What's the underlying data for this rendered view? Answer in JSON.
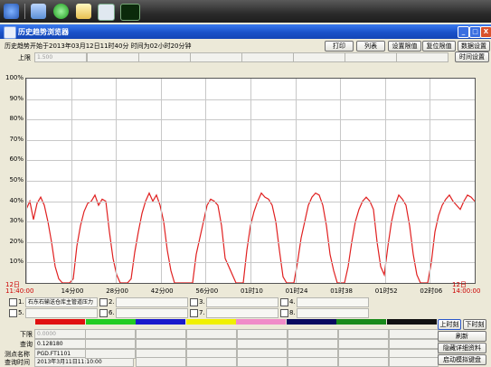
{
  "toolbar": {
    "icons": [
      "network-icon",
      "monitor-icon",
      "globe-icon",
      "notes-icon",
      "chart-icon",
      "signal-icon"
    ]
  },
  "window": {
    "title": "历史趋势浏览器",
    "min": "_",
    "max": "□",
    "close": "X"
  },
  "header": {
    "info": "历史趋势开始于2013年03月12日11时40分   时间为02小时20分钟",
    "upper_label": "上限",
    "upper_value": "1.500"
  },
  "buttons": {
    "print": "打印",
    "list": "列表",
    "set_limit": "设置限值",
    "reset_limit": "复位限值",
    "data_settings": "数据设置",
    "time_settings": "时间设置"
  },
  "chart_data": {
    "type": "line",
    "yticks": [
      "100%",
      "90%",
      "80%",
      "70%",
      "60%",
      "50%",
      "40%",
      "30%",
      "20%",
      "10%"
    ],
    "ylim": [
      0,
      100
    ],
    "xticks": [
      "12日\n11:40:00",
      "14分00",
      "28分00",
      "42分00",
      "56分00",
      "01时10",
      "01时24",
      "01时38",
      "01时52",
      "02时06",
      "12日\n14:00:00"
    ],
    "series": [
      {
        "color": "#e02020",
        "points": [
          [
            0,
            36
          ],
          [
            1,
            40
          ],
          [
            2,
            31
          ],
          [
            3,
            39
          ],
          [
            4,
            42
          ],
          [
            5,
            38
          ],
          [
            6,
            30
          ],
          [
            7,
            20
          ],
          [
            8,
            8
          ],
          [
            9,
            2
          ],
          [
            10,
            0
          ],
          [
            11,
            0
          ],
          [
            12,
            0
          ],
          [
            13,
            2
          ],
          [
            14,
            18
          ],
          [
            15,
            28
          ],
          [
            16,
            35
          ],
          [
            17,
            39
          ],
          [
            18,
            40
          ],
          [
            19,
            43
          ],
          [
            20,
            38
          ],
          [
            21,
            41
          ],
          [
            22,
            40
          ],
          [
            23,
            25
          ],
          [
            24,
            12
          ],
          [
            25,
            4
          ],
          [
            26,
            0
          ],
          [
            27,
            0
          ],
          [
            28,
            0
          ],
          [
            29,
            2
          ],
          [
            30,
            15
          ],
          [
            31,
            25
          ],
          [
            32,
            34
          ],
          [
            33,
            40
          ],
          [
            34,
            44
          ],
          [
            35,
            40
          ],
          [
            36,
            43
          ],
          [
            37,
            38
          ],
          [
            38,
            30
          ],
          [
            39,
            16
          ],
          [
            40,
            6
          ],
          [
            41,
            0
          ],
          [
            42,
            0
          ],
          [
            43,
            0
          ],
          [
            44,
            0
          ],
          [
            45,
            0
          ],
          [
            46,
            0
          ],
          [
            47,
            14
          ],
          [
            48,
            22
          ],
          [
            49,
            30
          ],
          [
            50,
            38
          ],
          [
            51,
            41
          ],
          [
            52,
            40
          ],
          [
            53,
            38
          ],
          [
            54,
            28
          ],
          [
            55,
            12
          ],
          [
            56,
            8
          ],
          [
            57,
            4
          ],
          [
            58,
            0
          ],
          [
            59,
            0
          ],
          [
            60,
            0
          ],
          [
            61,
            16
          ],
          [
            62,
            28
          ],
          [
            63,
            35
          ],
          [
            64,
            40
          ],
          [
            65,
            44
          ],
          [
            66,
            42
          ],
          [
            67,
            41
          ],
          [
            68,
            38
          ],
          [
            69,
            30
          ],
          [
            70,
            16
          ],
          [
            71,
            3
          ],
          [
            72,
            0
          ],
          [
            73,
            0
          ],
          [
            74,
            0
          ],
          [
            75,
            10
          ],
          [
            76,
            22
          ],
          [
            77,
            30
          ],
          [
            78,
            38
          ],
          [
            79,
            42
          ],
          [
            80,
            44
          ],
          [
            81,
            43
          ],
          [
            82,
            38
          ],
          [
            83,
            28
          ],
          [
            84,
            14
          ],
          [
            85,
            6
          ],
          [
            86,
            0
          ],
          [
            87,
            0
          ],
          [
            88,
            0
          ],
          [
            89,
            8
          ],
          [
            90,
            20
          ],
          [
            91,
            30
          ],
          [
            92,
            36
          ],
          [
            93,
            40
          ],
          [
            94,
            42
          ],
          [
            95,
            40
          ],
          [
            96,
            36
          ],
          [
            97,
            20
          ],
          [
            98,
            8
          ],
          [
            99,
            4
          ],
          [
            100,
            18
          ],
          [
            101,
            30
          ],
          [
            102,
            38
          ],
          [
            103,
            43
          ],
          [
            104,
            41
          ],
          [
            105,
            38
          ],
          [
            106,
            28
          ],
          [
            107,
            14
          ],
          [
            108,
            4
          ],
          [
            109,
            0
          ],
          [
            110,
            0
          ],
          [
            111,
            0
          ],
          [
            112,
            10
          ],
          [
            113,
            25
          ],
          [
            114,
            33
          ],
          [
            115,
            38
          ],
          [
            116,
            41
          ],
          [
            117,
            43
          ],
          [
            118,
            40
          ],
          [
            119,
            38
          ],
          [
            120,
            36
          ],
          [
            121,
            40
          ],
          [
            122,
            43
          ],
          [
            123,
            42
          ],
          [
            124,
            40
          ]
        ]
      }
    ]
  },
  "checks": [
    {
      "num": "1.",
      "label": "石东石输送仓库主管道压力"
    },
    {
      "num": "2.",
      "label": ""
    },
    {
      "num": "3.",
      "label": ""
    },
    {
      "num": "4.",
      "label": ""
    },
    {
      "num": "5.",
      "label": ""
    },
    {
      "num": "6.",
      "label": ""
    },
    {
      "num": "7.",
      "label": ""
    },
    {
      "num": "8.",
      "label": ""
    }
  ],
  "colors": [
    "#e01010",
    "#22cc22",
    "#1a1acc",
    "#f0f000",
    "#f08cc8",
    "#0a0a60",
    "#1a8a1a",
    "#111111"
  ],
  "footer": {
    "lower_label": "下限",
    "lower_value": "0.0000",
    "query_label": "查询",
    "query_value": "0.128180",
    "point_label": "测点名称",
    "point_value": "PGD.FT1101",
    "time_label": "查询时间",
    "time_value": "2013年3月11日11:10:00"
  },
  "side_buttons": {
    "up": "上时刻",
    "down": "下时刻",
    "refresh": "刷新",
    "hide": "隐藏详细资料",
    "simulate": "启动模拟键盘"
  }
}
